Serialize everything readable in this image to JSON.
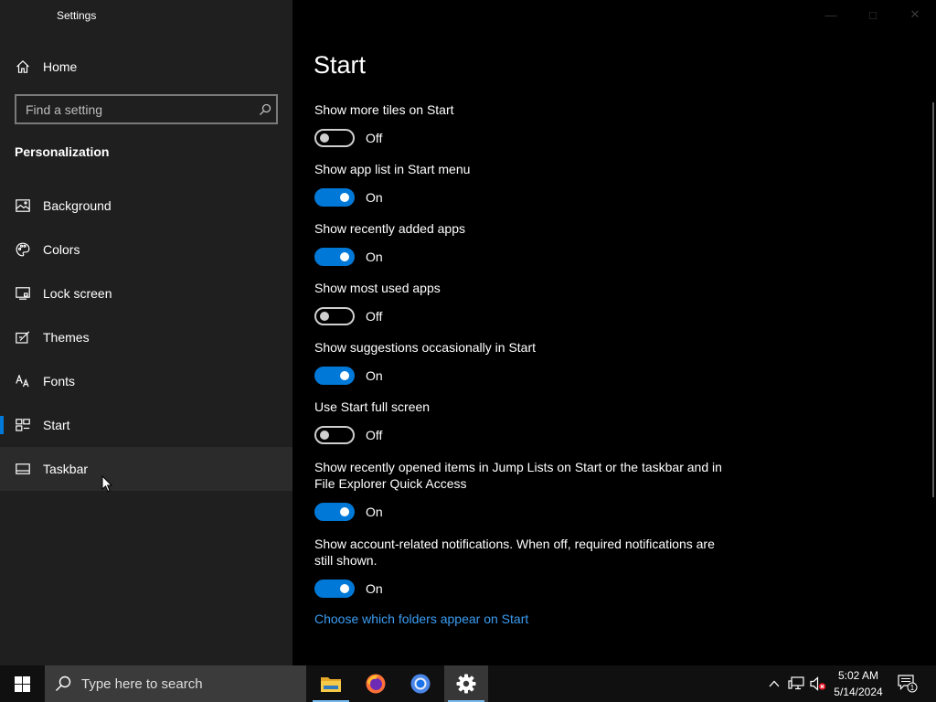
{
  "window": {
    "title": "Settings",
    "controls": [
      "minimize",
      "maximize",
      "close"
    ]
  },
  "sidebar": {
    "home_label": "Home",
    "search_placeholder": "Find a setting",
    "section_title": "Personalization",
    "items": [
      {
        "label": "Background",
        "icon": "picture-icon"
      },
      {
        "label": "Colors",
        "icon": "palette-icon"
      },
      {
        "label": "Lock screen",
        "icon": "lock-screen-icon"
      },
      {
        "label": "Themes",
        "icon": "themes-icon"
      },
      {
        "label": "Fonts",
        "icon": "fonts-icon"
      },
      {
        "label": "Start",
        "icon": "start-layout-icon",
        "selected": true
      },
      {
        "label": "Taskbar",
        "icon": "taskbar-icon",
        "hovered": true
      }
    ]
  },
  "main": {
    "page_title": "Start",
    "settings": [
      {
        "label": "Show more tiles on Start",
        "state": "Off"
      },
      {
        "label": "Show app list in Start menu",
        "state": "On"
      },
      {
        "label": "Show recently added apps",
        "state": "On"
      },
      {
        "label": "Show most used apps",
        "state": "Off"
      },
      {
        "label": "Show suggestions occasionally in Start",
        "state": "On"
      },
      {
        "label": "Use Start full screen",
        "state": "Off"
      },
      {
        "label": "Show recently opened items in Jump Lists on Start or the taskbar and in File Explorer Quick Access",
        "state": "On"
      },
      {
        "label": "Show account-related notifications. When off, required notifications are still shown.",
        "state": "On"
      }
    ],
    "link": "Choose which folders appear on Start"
  },
  "taskbar": {
    "search_placeholder": "Type here to search",
    "apps": [
      "File Explorer",
      "Firefox",
      "Chrome",
      "Settings"
    ],
    "active_app": "Settings",
    "clock": {
      "time": "5:02 AM",
      "date": "5/14/2024"
    },
    "notification_count": "1"
  },
  "colors": {
    "accent": "#0078d7",
    "link": "#3b9cf2",
    "sidebar_bg": "#1f1f1f",
    "main_bg": "#000000"
  }
}
